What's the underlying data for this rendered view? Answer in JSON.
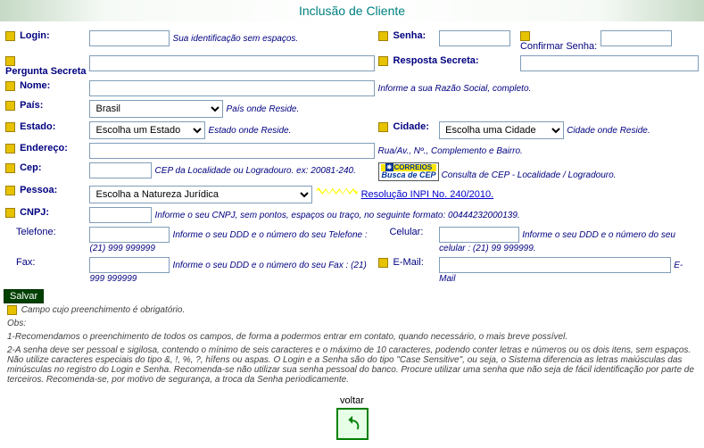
{
  "header": {
    "title": "Inclusão de Cliente"
  },
  "labels": {
    "login": "Login:",
    "senha": "Senha:",
    "confirmar_senha": "Confirmar Senha:",
    "pergunta_secreta": "Pergunta Secreta",
    "resposta_secreta": "Resposta Secreta:",
    "nome": "Nome:",
    "pais": "País:",
    "estado": "Estado:",
    "cidade": "Cidade:",
    "endereco": "Endereço:",
    "cep": "Cep:",
    "pessoa": "Pessoa:",
    "cnpj": "CNPJ:",
    "telefone": "Telefone:",
    "celular": "Celular:",
    "fax": "Fax:",
    "email": "E-Mail:"
  },
  "hints": {
    "login": "Sua identificação sem espaços.",
    "nome": "Informe a sua Razão Social, completo.",
    "pais": "País onde Reside.",
    "estado": "Estado onde Reside.",
    "cidade": "Cidade onde Reside.",
    "endereco": "Rua/Av., Nº., Complemento e Bairro.",
    "cep": "CEP da Localidade ou Logradouro. ex: 20081-240.",
    "cep_consulta": "Consulta de CEP - Localidade / Logradouro.",
    "cnpj": "Informe o seu CNPJ, sem pontos, espaços ou traço, no seguinte formato: 00444232000139.",
    "telefone": "Informe o seu DDD e o número do seu Telefone : (21) 999 999999",
    "celular": "Informe o seu DDD e o número do seu celular : (21) 99 999999.",
    "fax": "Informe o seu DDD e o número do seu Fax : (21) 999 999999",
    "email": "E-Mail"
  },
  "selects": {
    "pais": "Brasil",
    "estado": "Escolha um Estado",
    "cidade": "Escolha uma Cidade",
    "pessoa": "Escolha a Natureza Jurídica"
  },
  "links": {
    "resolucao": "Resolução INPI No. 240/2010."
  },
  "correios": {
    "top": "CORREIOS",
    "bottom": "Busca de CEP"
  },
  "buttons": {
    "salvar": "Salvar",
    "voltar": "voltar"
  },
  "notes": {
    "mandatory": "Campo cujo preenchimento é obrigatório.",
    "obs_title": "Obs:",
    "obs1": "1-Recomendamos o preenchimento de todos os campos, de forma a podermos entrar em contato, quando necessário, o mais breve possível.",
    "obs2": "2-A senha deve ser pessoal e sigilosa, contendo o mínimo de seis caracteres e o máximo de 10 caracteres, podendo conter letras e números ou os dois itens, sem espaços. Não utilize caracteres especiais do tipo &, !, %, ?, hífens ou aspas. O Login e a Senha são do tipo \"Case Sensitive\", ou seja, o Sistema diferencia as letras maiúsculas das minúsculas no registro do Login e Senha. Recomenda-se não utilizar sua senha pessoal do banco. Procure utilizar uma senha que não seja de fácil identificação por parte de terceiros. Recomenda-se, por motivo de segurança, a troca da Senha periodicamente."
  }
}
